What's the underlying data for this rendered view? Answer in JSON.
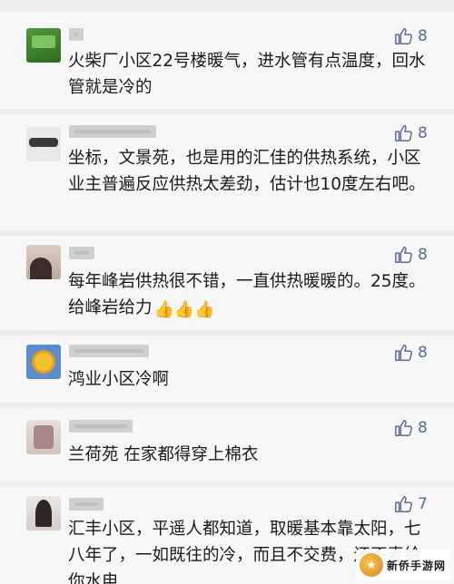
{
  "comments": [
    {
      "text": "火柴厂小区22号楼暖气，进水管有点温度，回水管就是冷的",
      "likes": "8",
      "emoji": ""
    },
    {
      "text": "坐标，文景苑，也是用的汇佳的供热系统，小区业主普遍反应供热太差劲，估计也10度左右吧。",
      "likes": "8",
      "emoji": ""
    },
    {
      "text": "每年峰岩供热很不错，一直供热暖暖的。25度。给峰岩给力",
      "likes": "8",
      "emoji": "👍👍👍"
    },
    {
      "text": "鸿业小区冷啊",
      "likes": "8",
      "emoji": ""
    },
    {
      "text": "兰荷苑 在家都得穿上棉衣",
      "likes": "8",
      "emoji": ""
    },
    {
      "text": "汇丰小区，平遥人都知道，取暖基本靠太阳，七八年了，一如既往的冷，而且不交费，还不麦给你水电",
      "likes": "7",
      "emoji": ""
    }
  ],
  "icons": {
    "like": "thumbs-up-icon"
  },
  "colors": {
    "like_count": "#576b95"
  },
  "watermark": {
    "text": "新侨手游网"
  }
}
